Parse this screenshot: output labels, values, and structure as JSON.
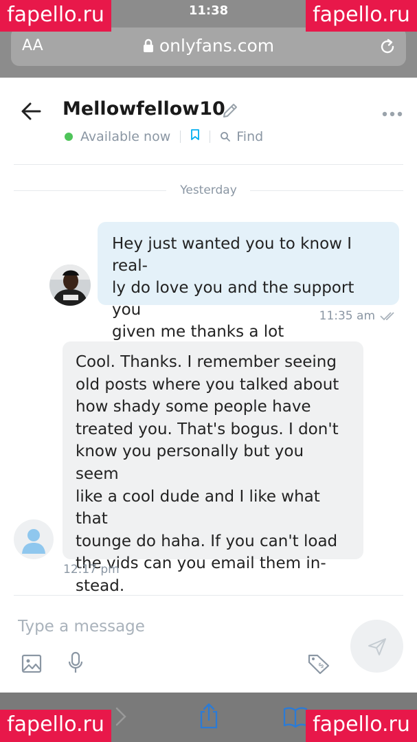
{
  "browser": {
    "time": "11:38",
    "text_size_label": "AA",
    "url": "onlyfans.com"
  },
  "watermarks": [
    "fapello.ru",
    "fapello.ru",
    "fapello.ru",
    "fapello.ru"
  ],
  "chat": {
    "username": "Mellowfellow10",
    "status": "Available now",
    "find_label": "Find",
    "day_separator": "Yesterday"
  },
  "messages": [
    {
      "direction": "outgoing",
      "lines": [
        "Hey just wanted you to know I real-",
        "ly do love you and the support you",
        "given me thanks a lot"
      ],
      "time": "11:35 am"
    },
    {
      "direction": "incoming",
      "lines": [
        "Cool. Thanks. I remember seeing",
        "old posts where you talked about",
        "how shady some people have",
        "treated you. That's bogus. I don't",
        "know you personally but you seem",
        "like a cool dude and I like what that",
        "tounge do haha. If you can't load",
        "the vids can you email them in-",
        "stead."
      ],
      "time": "12:17 pm"
    }
  ],
  "composer": {
    "placeholder": "Type a message"
  },
  "colors": {
    "accent": "#00aff0",
    "online": "#4fc45a",
    "outgoing_bubble": "#e4f1f9",
    "incoming_bubble": "#f0f1f2",
    "muted_text": "#8a96a3",
    "watermark": "#e8184a"
  },
  "icons": [
    "lock-icon",
    "reload-icon",
    "back-arrow-icon",
    "pencil-icon",
    "more-icon",
    "bookmark-icon",
    "search-icon",
    "double-check-icon",
    "user-icon",
    "send-icon",
    "image-icon",
    "microphone-icon",
    "price-tag-icon",
    "share-icon",
    "bookmarks-icon",
    "forward-icon"
  ]
}
